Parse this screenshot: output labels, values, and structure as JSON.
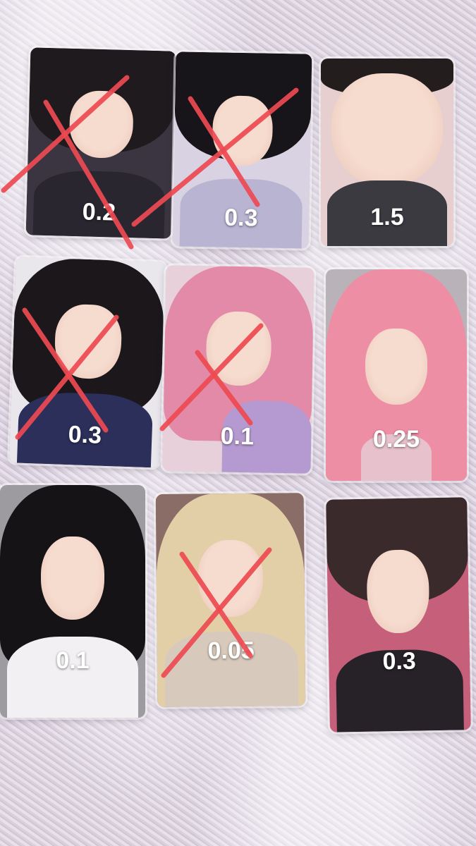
{
  "colors": {
    "cross": "#ee4a52",
    "price_text": "#ffffff"
  },
  "cards": [
    {
      "price": "0.2",
      "crossed": true,
      "hair": "#1e1a1e",
      "top": "#2a2630",
      "bg": "#3a3540"
    },
    {
      "price": "0.3",
      "crossed": true,
      "hair": "#17141a",
      "top": "#b9b4d2",
      "bg": "#d8d2e2"
    },
    {
      "price": "1.5",
      "crossed": false,
      "hair": "#231d1e",
      "top": "#3b3a40",
      "bg": "#e7cfcf"
    },
    {
      "price": "0.3",
      "crossed": true,
      "hair": "#1b171b",
      "top": "#2c2f5a",
      "bg": "#e9e6ec"
    },
    {
      "price": "0.1",
      "crossed": true,
      "hair": "#e28aa8",
      "top": "#b49ad0",
      "bg": "#e7d0da"
    },
    {
      "price": "0.25",
      "crossed": false,
      "hair": "#ee8ea4",
      "top": "#e7c2cc",
      "bg": "#b9b2b8"
    },
    {
      "price": "0.1",
      "crossed": false,
      "hair": "#161316",
      "top": "#f2f0f2",
      "bg": "#9e9ba0"
    },
    {
      "price": "0.05",
      "crossed": true,
      "hair": "#e2cfa8",
      "top": "#d8c9bd",
      "bg": "#8a6d66"
    },
    {
      "price": "0.3",
      "crossed": false,
      "hair": "#3a2a2c",
      "top": "#262228",
      "bg": "#c55f7a"
    }
  ]
}
